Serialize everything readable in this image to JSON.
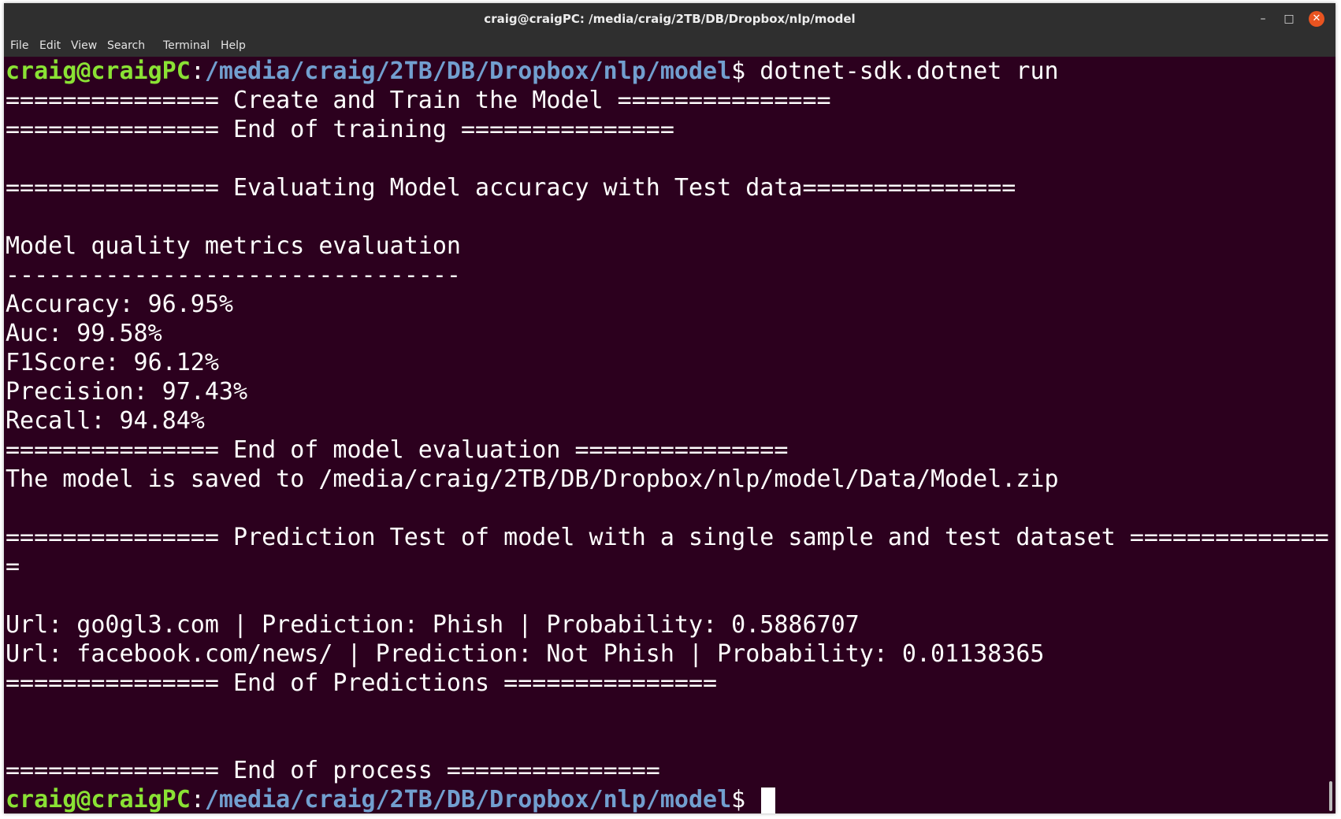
{
  "window": {
    "title": "craig@craigPC: /media/craig/2TB/DB/Dropbox/nlp/model",
    "minimize_label": "–",
    "maximize_label": "□",
    "close_label": "✕"
  },
  "menu": {
    "file": "File",
    "edit": "Edit",
    "view": "View",
    "search": "Search",
    "terminal": "Terminal",
    "help": "Help"
  },
  "terminal": {
    "prompt_user": "craig@craigPC",
    "prompt_path": "/media/craig/2TB/DB/Dropbox/nlp/model",
    "prompt_sep": ":",
    "prompt_symbol": "$ ",
    "command": "dotnet-sdk.dotnet run",
    "lines": [
      "=============== Create and Train the Model ===============",
      "=============== End of training ===============",
      "",
      "=============== Evaluating Model accuracy with Test data===============",
      "",
      "Model quality metrics evaluation",
      "--------------------------------",
      "Accuracy: 96.95%",
      "Auc: 99.58%",
      "F1Score: 96.12%",
      "Precision: 97.43%",
      "Recall: 94.84%",
      "=============== End of model evaluation ===============",
      "The model is saved to /media/craig/2TB/DB/Dropbox/nlp/model/Data/Model.zip",
      "",
      "=============== Prediction Test of model with a single sample and test dataset ==============",
      "=",
      "",
      "Url: go0gl3.com | Prediction: Phish | Probability: 0.5886707",
      "Url: facebook.com/news/ | Prediction: Not Phish | Probability: 0.01138365",
      "=============== End of Predictions ===============",
      "",
      "",
      "=============== End of process ==============="
    ]
  },
  "colors": {
    "terminal_background": "#2c001e",
    "prompt_user": "#8ae234",
    "prompt_path": "#729fcf",
    "close_button": "#e95420",
    "titlebar": "#2f2f2f"
  }
}
